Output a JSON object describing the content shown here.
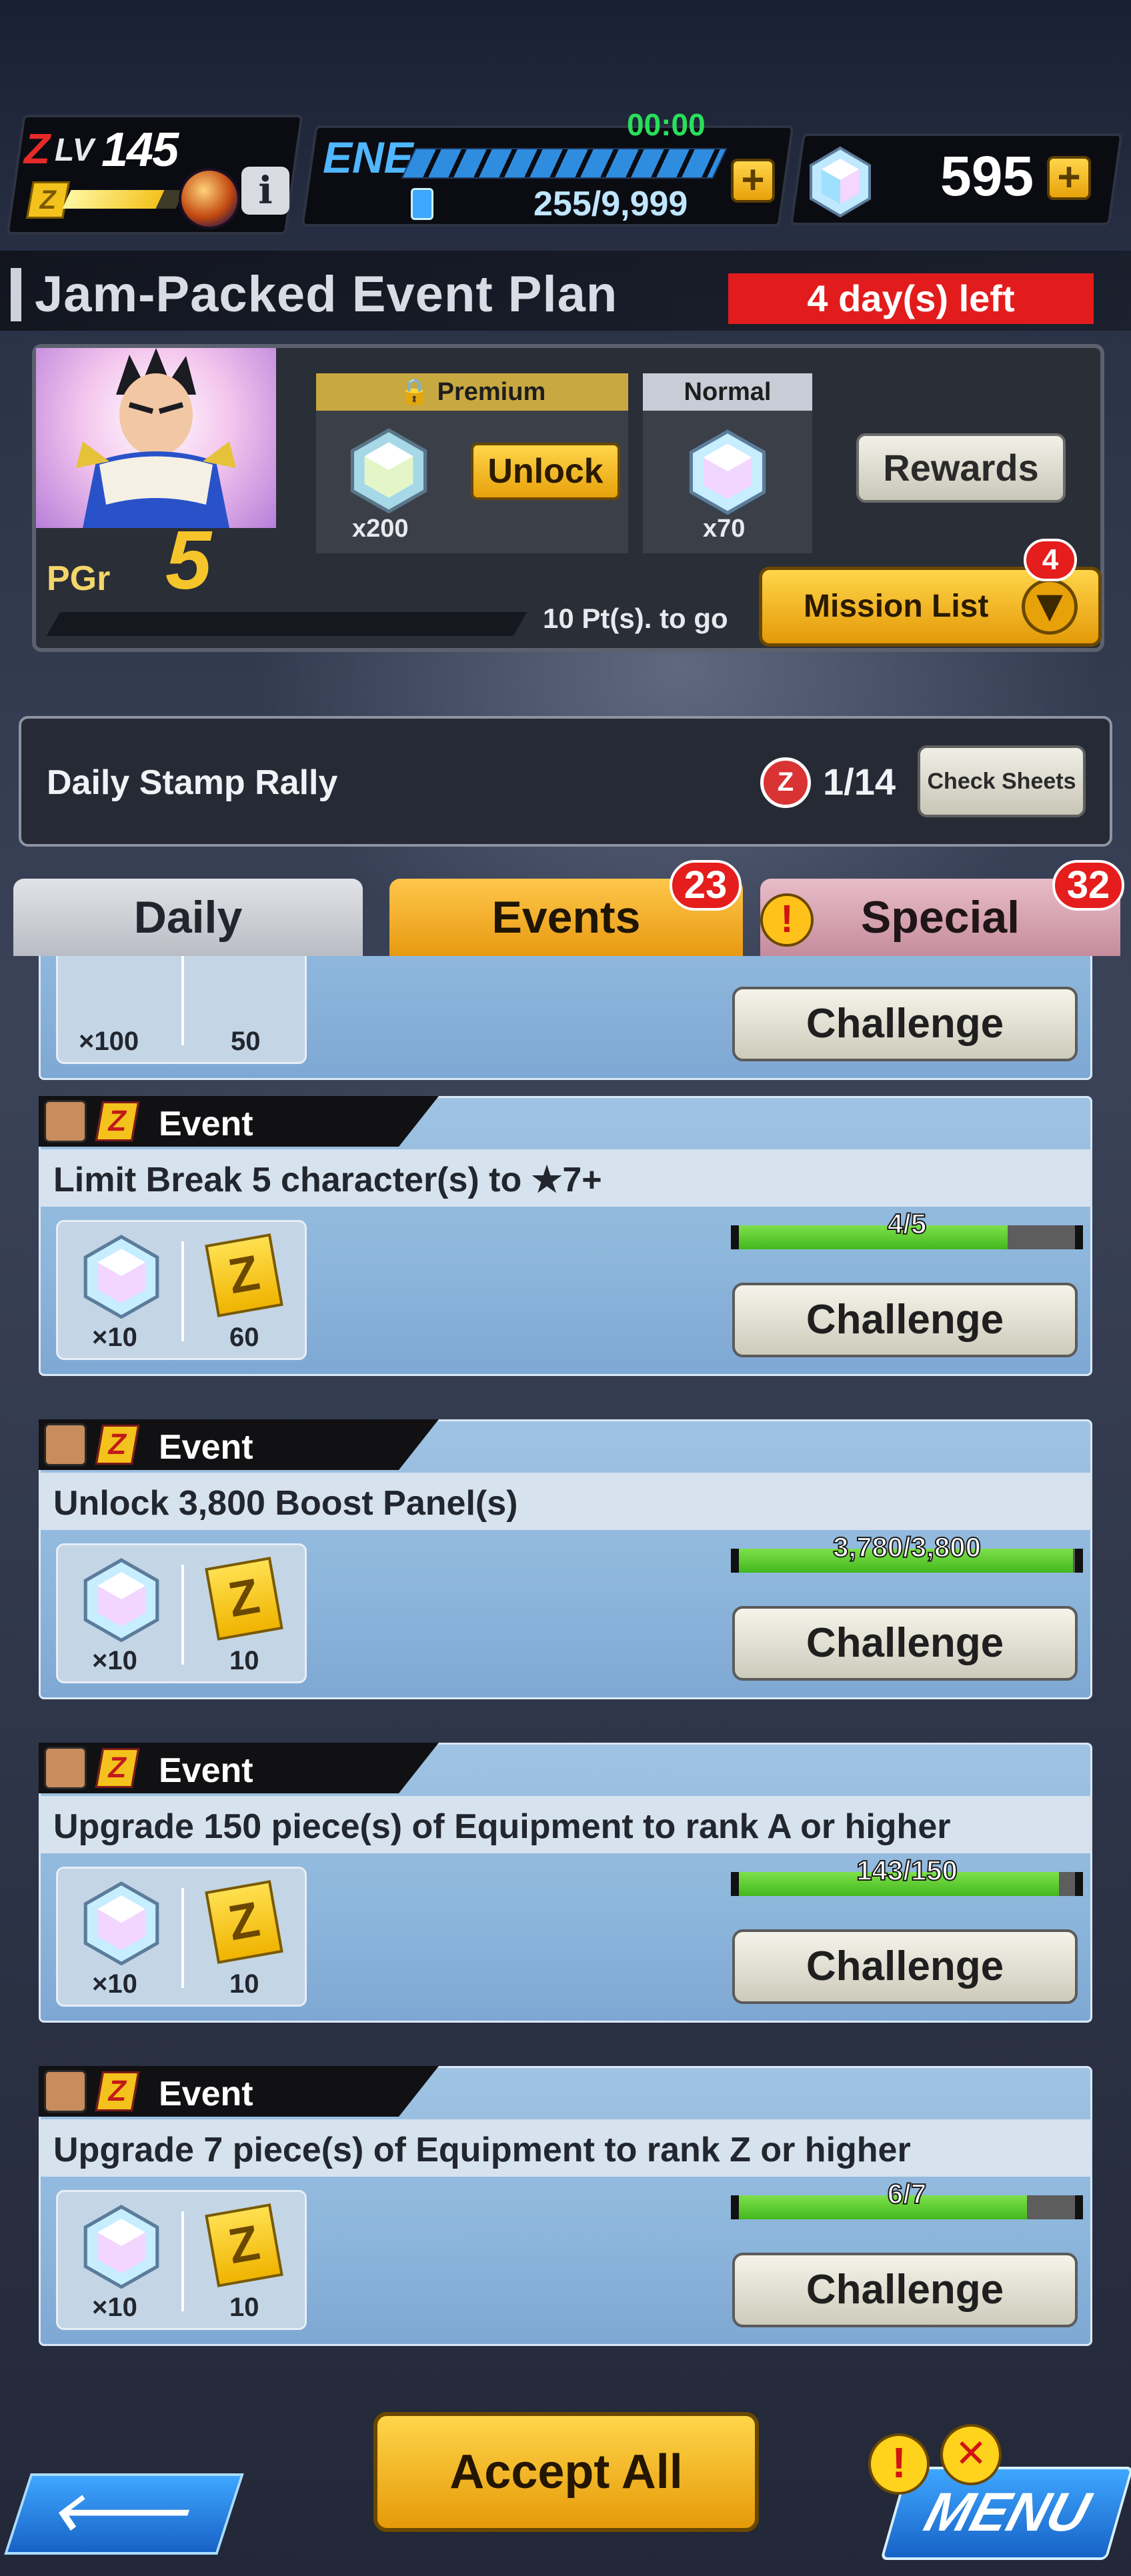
{
  "status_bar": {
    "rank_prefix": "Z",
    "level_label": "LV",
    "level": "145",
    "exp_icon": "Z",
    "info_icon": "i",
    "energy_label": "ENE",
    "energy_timer": "00:00",
    "energy_value": "255/9,999",
    "crystals": "595",
    "plus_label": "+"
  },
  "event": {
    "title": "Jam-Packed Event Plan",
    "time_left": "4 day(s) left"
  },
  "pass": {
    "pgr_label": "PGr",
    "pgr_value": "5",
    "points_to_go": "10 Pt(s). to go",
    "premium_label": "Premium",
    "premium_qty": "x200",
    "unlock_label": "Unlock",
    "normal_label": "Normal",
    "normal_qty": "x70",
    "rewards_label": "Rewards",
    "mission_list_label": "Mission List",
    "mission_badge": "4"
  },
  "stamp_rally": {
    "title": "Daily Stamp Rally",
    "icon": "Z",
    "count": "1/14",
    "check_label": "Check Sheets"
  },
  "tabs": {
    "daily": "Daily",
    "events": "Events",
    "events_badge": "23",
    "special": "Special",
    "special_badge": "32",
    "alert": "!"
  },
  "missions": [
    {
      "type": "",
      "description": "",
      "reward_gem_qty": "×100",
      "reward_z_qty": "50",
      "progress": "",
      "progress_ratio": 1,
      "button": "Challenge",
      "partial": true
    },
    {
      "type": "Event",
      "description": "Limit Break 5 character(s) to ★7+",
      "reward_gem_qty": "×10",
      "reward_z_qty": "60",
      "progress": "4/5",
      "progress_ratio": 0.8,
      "button": "Challenge"
    },
    {
      "type": "Event",
      "description": "Unlock 3,800 Boost Panel(s)",
      "reward_gem_qty": "×10",
      "reward_z_qty": "10",
      "progress": "3,780/3,800",
      "progress_ratio": 0.995,
      "button": "Challenge"
    },
    {
      "type": "Event",
      "description": "Upgrade 150 piece(s) of Equipment to rank A or higher",
      "reward_gem_qty": "×10",
      "reward_z_qty": "10",
      "progress": "143/150",
      "progress_ratio": 0.953,
      "button": "Challenge"
    },
    {
      "type": "Event",
      "description": "Upgrade 7 piece(s) of Equipment to rank Z or higher",
      "reward_gem_qty": "×10",
      "reward_z_qty": "10",
      "progress": "6/7",
      "progress_ratio": 0.857,
      "button": "Challenge"
    }
  ],
  "bottom": {
    "back_icon": "🡐",
    "accept_all": "Accept All",
    "menu_label": "MENU",
    "menu_alert": "!",
    "menu_alert2": "✕"
  },
  "colors": {
    "accent_gold": "#e7a20a",
    "badge_red": "#e51d1d",
    "progress_green": "#43b81e",
    "card_blue": "#8db6dc"
  }
}
